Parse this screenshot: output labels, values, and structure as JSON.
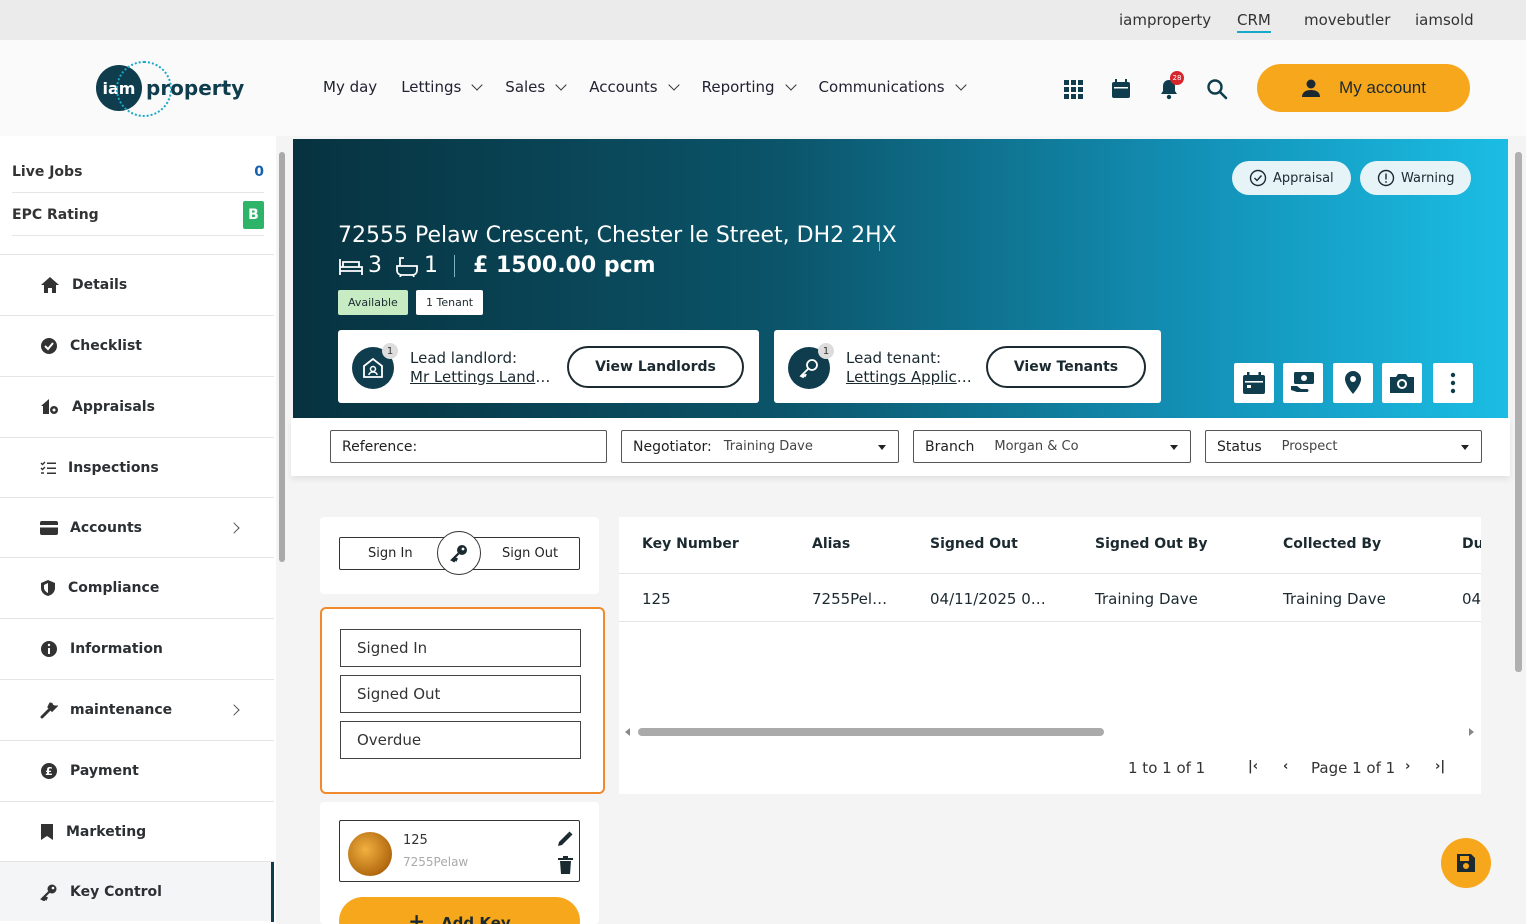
{
  "topnav": [
    "iamproperty",
    "CRM",
    "movebutler",
    "iamsold"
  ],
  "brand": {
    "logo_left": "iam",
    "logo_right": "property"
  },
  "mainnav": [
    "My day",
    "Lettings",
    "Sales",
    "Accounts",
    "Reporting",
    "Communications"
  ],
  "header": {
    "notifications_count": "28",
    "my_account_label": "My account"
  },
  "sidebar": {
    "stats": [
      {
        "label": "Live Jobs",
        "value": "0"
      },
      {
        "label": "EPC Rating",
        "value": "B"
      }
    ],
    "items": [
      {
        "label": "Details",
        "icon": "home-icon"
      },
      {
        "label": "Checklist",
        "icon": "check-circle-icon"
      },
      {
        "label": "Appraisals",
        "icon": "home-gear-icon"
      },
      {
        "label": "Inspections",
        "icon": "list-check-icon"
      },
      {
        "label": "Accounts",
        "icon": "card-icon",
        "has_submenu": true
      },
      {
        "label": "Compliance",
        "icon": "shield-icon"
      },
      {
        "label": "Information",
        "icon": "info-icon"
      },
      {
        "label": "maintenance",
        "icon": "wrench-icon",
        "has_submenu": true
      },
      {
        "label": "Payment",
        "icon": "pound-coin-icon"
      },
      {
        "label": "Marketing",
        "icon": "bookmark-icon"
      },
      {
        "label": "Key Control",
        "icon": "key-icon",
        "active": true
      }
    ]
  },
  "property": {
    "address": "72555 Pelaw Crescent, Chester le Street, DH2 2HX",
    "bedrooms": "3",
    "bathrooms": "1",
    "price": "£ 1500.00 pcm",
    "tags": [
      "Available",
      "1 Tenant"
    ],
    "pills": [
      "Appraisal",
      "Warning"
    ],
    "lead_landlord": {
      "title": "Lead landlord:",
      "name": "Mr Lettings Landlord",
      "count": "1",
      "button": "View Landlords"
    },
    "lead_tenant": {
      "title": "Lead tenant:",
      "name": "Lettings Applicant",
      "count": "1",
      "button": "View Tenants"
    }
  },
  "filters": {
    "reference_label": "Reference:",
    "negotiator_label": "Negotiator:",
    "negotiator_value": "Training Dave",
    "branch_label": "Branch",
    "branch_value": "Morgan & Co",
    "status_label": "Status",
    "status_value": "Prospect"
  },
  "keys": {
    "sign_in": "Sign In",
    "sign_out": "Sign Out",
    "filter_buttons": [
      "Signed In",
      "Signed Out",
      "Overdue"
    ],
    "item": {
      "number": "125",
      "alias": "7255Pelaw"
    },
    "add_key": "Add Key"
  },
  "grid": {
    "columns": [
      "Key Number",
      "Alias",
      "Signed Out",
      "Signed Out By",
      "Collected By",
      "Du"
    ],
    "rows": [
      [
        "125",
        "7255Pel…",
        "04/11/2025 0…",
        "Training Dave",
        "Training Dave",
        "04"
      ]
    ],
    "range_text": "1 to 1 of 1",
    "page_text": "Page 1 of 1"
  },
  "colors": {
    "accent": "#f7a71c",
    "brand_dark": "#0f3d4d",
    "highlight": "#f08a2c",
    "available": "#c7ecc4"
  }
}
